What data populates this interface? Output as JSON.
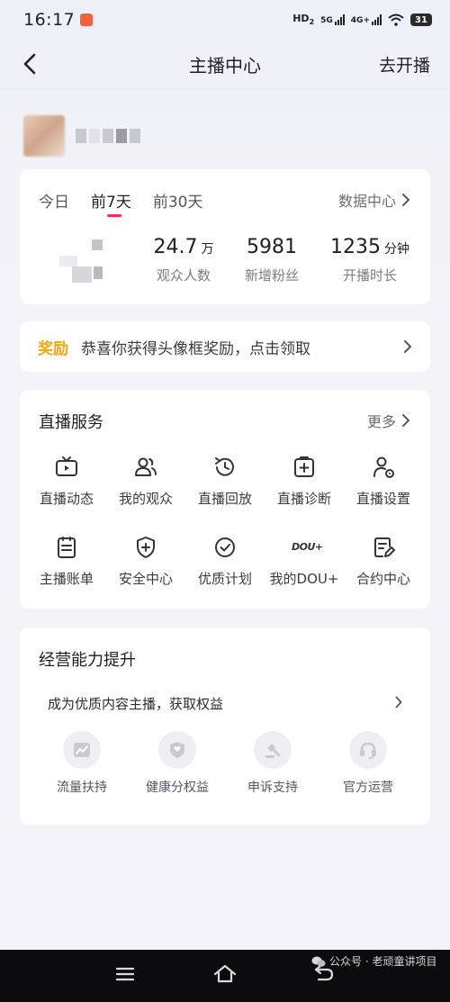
{
  "status_bar": {
    "time": "16:17",
    "network_1": "HD",
    "network_1_sub": "2",
    "network_2": "5G",
    "network_3": "4G+",
    "battery": "31"
  },
  "nav": {
    "title": "主播中心",
    "action": "去开播"
  },
  "stats": {
    "tabs": [
      "今日",
      "前7天",
      "前30天"
    ],
    "active_tab": "前7天",
    "data_center": "数据中心",
    "items": [
      {
        "value": "24.7",
        "unit": "万",
        "label": "观众人数"
      },
      {
        "value": "5981",
        "unit": "",
        "label": "新增粉丝"
      },
      {
        "value": "1235",
        "unit": "分钟",
        "label": "开播时长"
      }
    ]
  },
  "reward": {
    "tag": "奖励",
    "text": "恭喜你获得头像框奖励，点击领取",
    "tag_color": "#f5a50d"
  },
  "services": {
    "title": "直播服务",
    "more": "更多",
    "items": [
      {
        "label": "直播动态",
        "icon": "tv-icon"
      },
      {
        "label": "我的观众",
        "icon": "audience-icon"
      },
      {
        "label": "直播回放",
        "icon": "replay-clock-icon"
      },
      {
        "label": "直播诊断",
        "icon": "diagnose-icon"
      },
      {
        "label": "直播设置",
        "icon": "user-settings-icon"
      },
      {
        "label": "主播账单",
        "icon": "bill-icon"
      },
      {
        "label": "安全中心",
        "icon": "shield-plus-icon"
      },
      {
        "label": "优质计划",
        "icon": "check-circle-icon"
      },
      {
        "label": "我的DOU+",
        "icon": "dou-logo-icon",
        "logo_text": "DOU+"
      },
      {
        "label": "合约中心",
        "icon": "contract-edit-icon"
      }
    ]
  },
  "business": {
    "title": "经营能力提升",
    "subtitle": "成为优质内容主播，获取权益",
    "items": [
      {
        "label": "流量扶持",
        "icon": "traffic-icon"
      },
      {
        "label": "健康分权益",
        "icon": "health-shield-icon"
      },
      {
        "label": "申诉支持",
        "icon": "appeal-gavel-icon"
      },
      {
        "label": "官方运营",
        "icon": "headset-icon"
      }
    ]
  },
  "watermark": {
    "text": "公众号 · 老顽童讲项目"
  },
  "colors": {
    "accent": "#fe2c55",
    "reward": "#f5a50d",
    "background": "#f4f4f8"
  }
}
